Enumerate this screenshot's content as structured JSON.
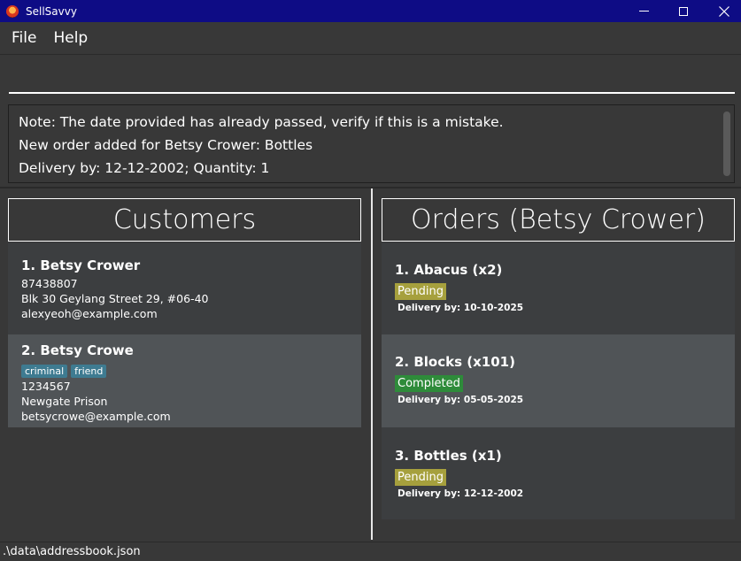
{
  "window": {
    "title": "SellSavvy"
  },
  "menu": {
    "file_label": "File",
    "help_label": "Help"
  },
  "command": {
    "value": ""
  },
  "result": {
    "lines": [
      "Note: The date provided has already passed, verify if this is a mistake.",
      "New order added for Betsy Crower: Bottles",
      "Delivery by: 12-12-2002; Quantity: 1"
    ]
  },
  "customers": {
    "header": "Customers",
    "items": [
      {
        "name": "1.  Betsy Crower",
        "tags": [],
        "phone": "87438807",
        "address": "Blk 30 Geylang Street 29, #06-40",
        "email": "alexyeoh@example.com"
      },
      {
        "name": "2.  Betsy Crowe",
        "tags": [
          "criminal",
          "friend"
        ],
        "phone": "1234567",
        "address": "Newgate Prison",
        "email": "betsycrowe@example.com"
      }
    ]
  },
  "orders": {
    "header": "Orders (Betsy Crower)",
    "items": [
      {
        "name": "1. Abacus (x2)",
        "status": "Pending",
        "delivery": "Delivery by: 10-10-2025"
      },
      {
        "name": "2. Blocks (x101)",
        "status": "Completed",
        "delivery": "Delivery by: 05-05-2025"
      },
      {
        "name": "3. Bottles (x1)",
        "status": "Pending",
        "delivery": "Delivery by: 12-12-2002"
      }
    ]
  },
  "statusbar": {
    "path": ".\\data\\addressbook.json"
  },
  "colors": {
    "titlebar": "#0e0c85",
    "pending": "#a6a03d",
    "completed": "#2e8b3a",
    "tag": "#3e7b91"
  },
  "icons": {
    "app": "sellsavvy-logo-icon",
    "minimize": "minimize-icon",
    "maximize": "maximize-icon",
    "close": "close-icon"
  }
}
